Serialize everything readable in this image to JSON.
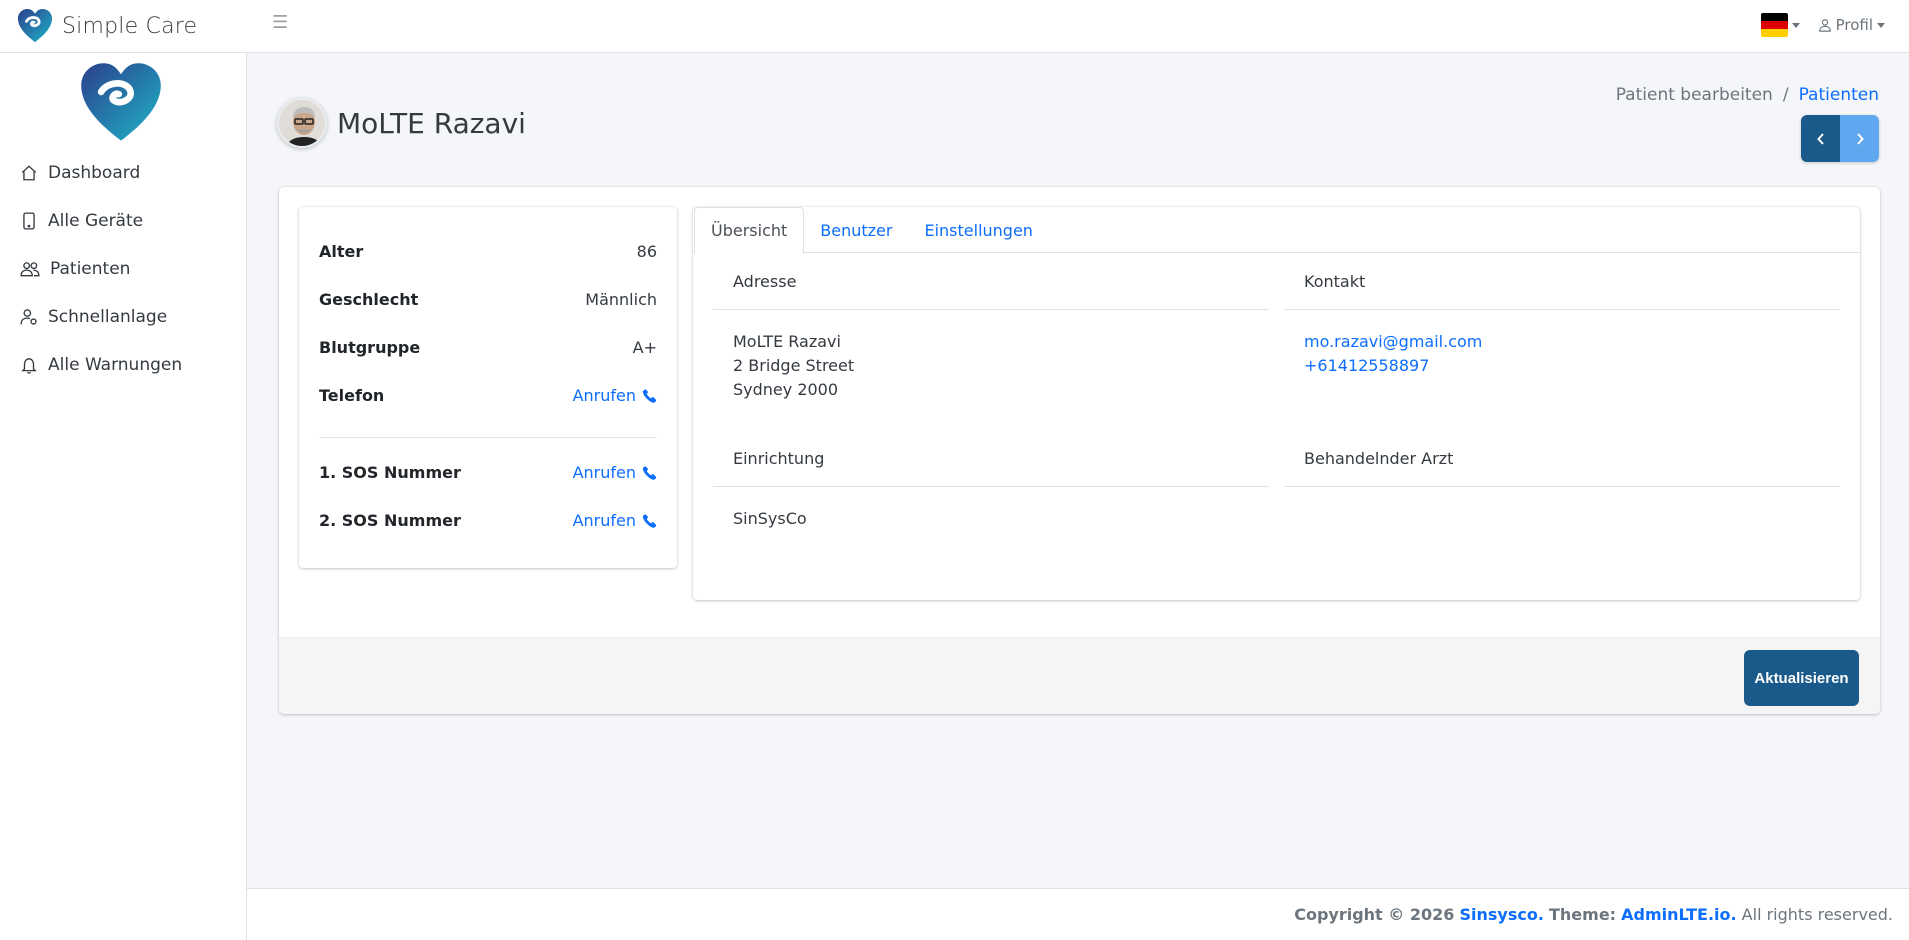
{
  "brand": {
    "name": "Simple Care"
  },
  "navbar": {
    "profile_label": "Profil",
    "flag_colors": [
      "#000000",
      "#dd0000",
      "#ffce00"
    ]
  },
  "sidebar": {
    "items": [
      {
        "label": "Dashboard",
        "icon": "home-icon"
      },
      {
        "label": "Alle Geräte",
        "icon": "tablet-icon"
      },
      {
        "label": "Patienten",
        "icon": "people-icon"
      },
      {
        "label": "Schnellanlage",
        "icon": "user-gear-icon"
      },
      {
        "label": "Alle Warnungen",
        "icon": "bell-icon"
      }
    ]
  },
  "page": {
    "title": "MoLTE Razavi",
    "breadcrumb": {
      "current": "Patient bearbeiten",
      "separator": "/",
      "link": "Patienten"
    }
  },
  "info": {
    "rows": [
      {
        "label": "Alter",
        "value": "86"
      },
      {
        "label": "Geschlecht",
        "value": "Männlich"
      },
      {
        "label": "Blutgruppe",
        "value": "A+"
      },
      {
        "label": "Telefon",
        "value": "Anrufen"
      }
    ],
    "sos": [
      {
        "label": "1. SOS Nummer",
        "value": "Anrufen"
      },
      {
        "label": "2. SOS Nummer",
        "value": "Anrufen"
      }
    ]
  },
  "tabs": [
    "Übersicht",
    "Benutzer",
    "Einstellungen"
  ],
  "overview": {
    "address": {
      "heading": "Adresse",
      "lines": [
        "MoLTE Razavi",
        "2 Bridge Street",
        "Sydney 2000"
      ]
    },
    "contact": {
      "heading": "Kontakt",
      "email": "mo.razavi@gmail.com",
      "phone": "+61412558897"
    },
    "facility": {
      "heading": "Einrichtung",
      "value": "SinSysCo"
    },
    "doctor": {
      "heading": "Behandelnder Arzt",
      "value": ""
    }
  },
  "actions": {
    "update_label": "Aktualisieren"
  },
  "footer": {
    "copyright": "Copyright © 2026",
    "company": "Sinsysco.",
    "theme_label": "Theme:",
    "theme": "AdminLTE.io.",
    "rights": "All rights reserved."
  },
  "colors": {
    "primary": "#1a5a8a",
    "link": "#0d6efd",
    "accent": "#5fa8f0"
  }
}
